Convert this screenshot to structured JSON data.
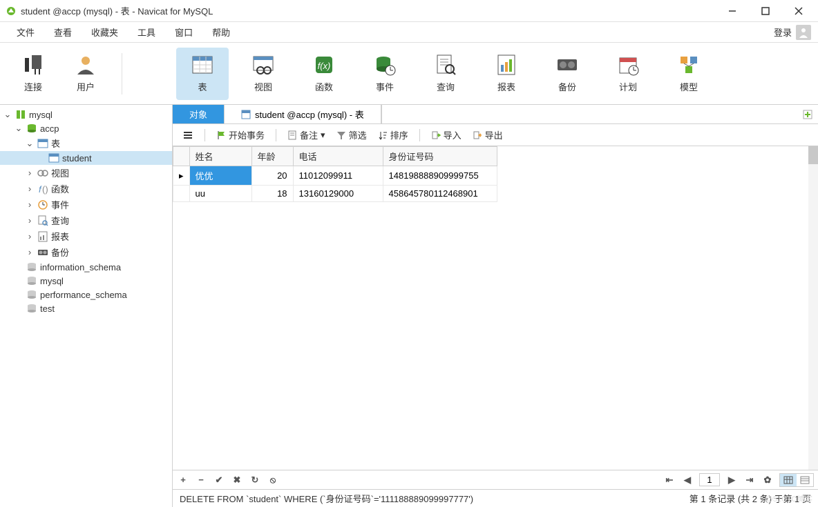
{
  "window": {
    "title": "student @accp (mysql) - 表 - Navicat for MySQL"
  },
  "menu": {
    "items": [
      "文件",
      "查看",
      "收藏夹",
      "工具",
      "窗口",
      "帮助"
    ],
    "login": "登录"
  },
  "toolbar": {
    "connect": "连接",
    "user": "用户",
    "table": "表",
    "view": "视图",
    "func": "函数",
    "event": "事件",
    "query": "查询",
    "report": "报表",
    "backup": "备份",
    "plan": "计划",
    "model": "模型"
  },
  "tree": {
    "root_mysql": "mysql",
    "accp": "accp",
    "tables": "表",
    "student": "student",
    "views": "视图",
    "funcs": "函数",
    "events": "事件",
    "queries": "查询",
    "reports": "报表",
    "backups": "备份",
    "info_schema": "information_schema",
    "db_mysql": "mysql",
    "perf_schema": "performance_schema",
    "test": "test"
  },
  "tabs": {
    "object": "对象",
    "student_tab": "student @accp (mysql) - 表"
  },
  "subtoolbar": {
    "begin_txn": "开始事务",
    "memo": "备注",
    "filter": "筛选",
    "sort": "排序",
    "import": "导入",
    "export": "导出"
  },
  "columns": {
    "name": "姓名",
    "age": "年龄",
    "phone": "电话",
    "idno": "身份证号码"
  },
  "rows": [
    {
      "name": "优优",
      "age": "20",
      "phone": "11012099911",
      "idno": "148198888909999755"
    },
    {
      "name": "uu",
      "age": "18",
      "phone": "13160129000",
      "idno": "458645780112468901"
    }
  ],
  "footer": {
    "page": "1"
  },
  "status": {
    "sql": "DELETE FROM `student` WHERE (`身份证号码`='111188889099997777')",
    "info": "第 1 条记录 (共 2 条) 于第 1 页"
  },
  "watermark": "@51CTO博客"
}
